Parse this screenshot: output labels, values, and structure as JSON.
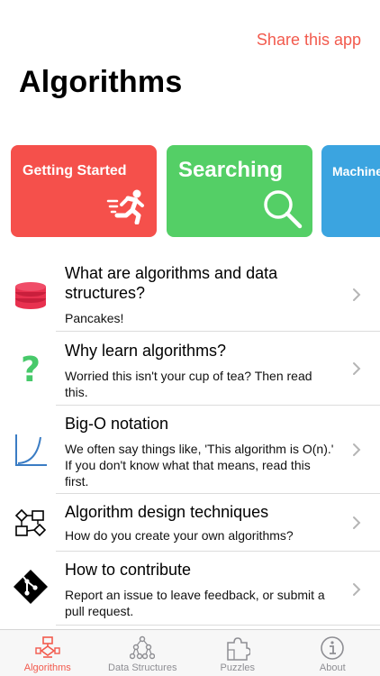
{
  "header": {
    "share_label": "Share this app",
    "title": "Algorithms"
  },
  "cards": [
    {
      "label": "Getting Started",
      "color": "#f5504b",
      "icon": "running-person-icon"
    },
    {
      "label": "Searching",
      "color": "#54cf66",
      "icon": "magnifier-icon"
    },
    {
      "label": "Machine",
      "color": "#3ba4e0",
      "icon": ""
    }
  ],
  "rows": [
    {
      "title": "What are algorithms and data structures?",
      "subtitle": "Pancakes!",
      "icon": "pancake-stack-icon"
    },
    {
      "title": "Why learn algorithms?",
      "subtitle": "Worried this isn't your cup of tea? Then read this.",
      "icon": "question-mark-icon"
    },
    {
      "title": "Big-O notation",
      "subtitle": "We often say things like, 'This algorithm is O(n).' If you don't know what that means, read this first.",
      "icon": "graph-curve-icon"
    },
    {
      "title": "Algorithm design techniques",
      "subtitle": "How do you create your own algorithms?",
      "icon": "flowchart-icon"
    },
    {
      "title": "How to contribute",
      "subtitle": "Report an issue to leave feedback, or submit a pull request.",
      "icon": "git-icon"
    }
  ],
  "tabs": [
    {
      "label": "Algorithms",
      "active": true,
      "icon": "algorithms-tab-icon"
    },
    {
      "label": "Data Structures",
      "active": false,
      "icon": "tree-icon"
    },
    {
      "label": "Puzzles",
      "active": false,
      "icon": "puzzle-icon"
    },
    {
      "label": "About",
      "active": false,
      "icon": "info-icon"
    }
  ],
  "colors": {
    "accent": "#f25a4d",
    "card_red": "#f5504b",
    "card_green": "#54cf66",
    "card_blue": "#3ba4e0",
    "pancake": "#e8314f",
    "question": "#47c96a",
    "graph": "#3a7cc4"
  }
}
